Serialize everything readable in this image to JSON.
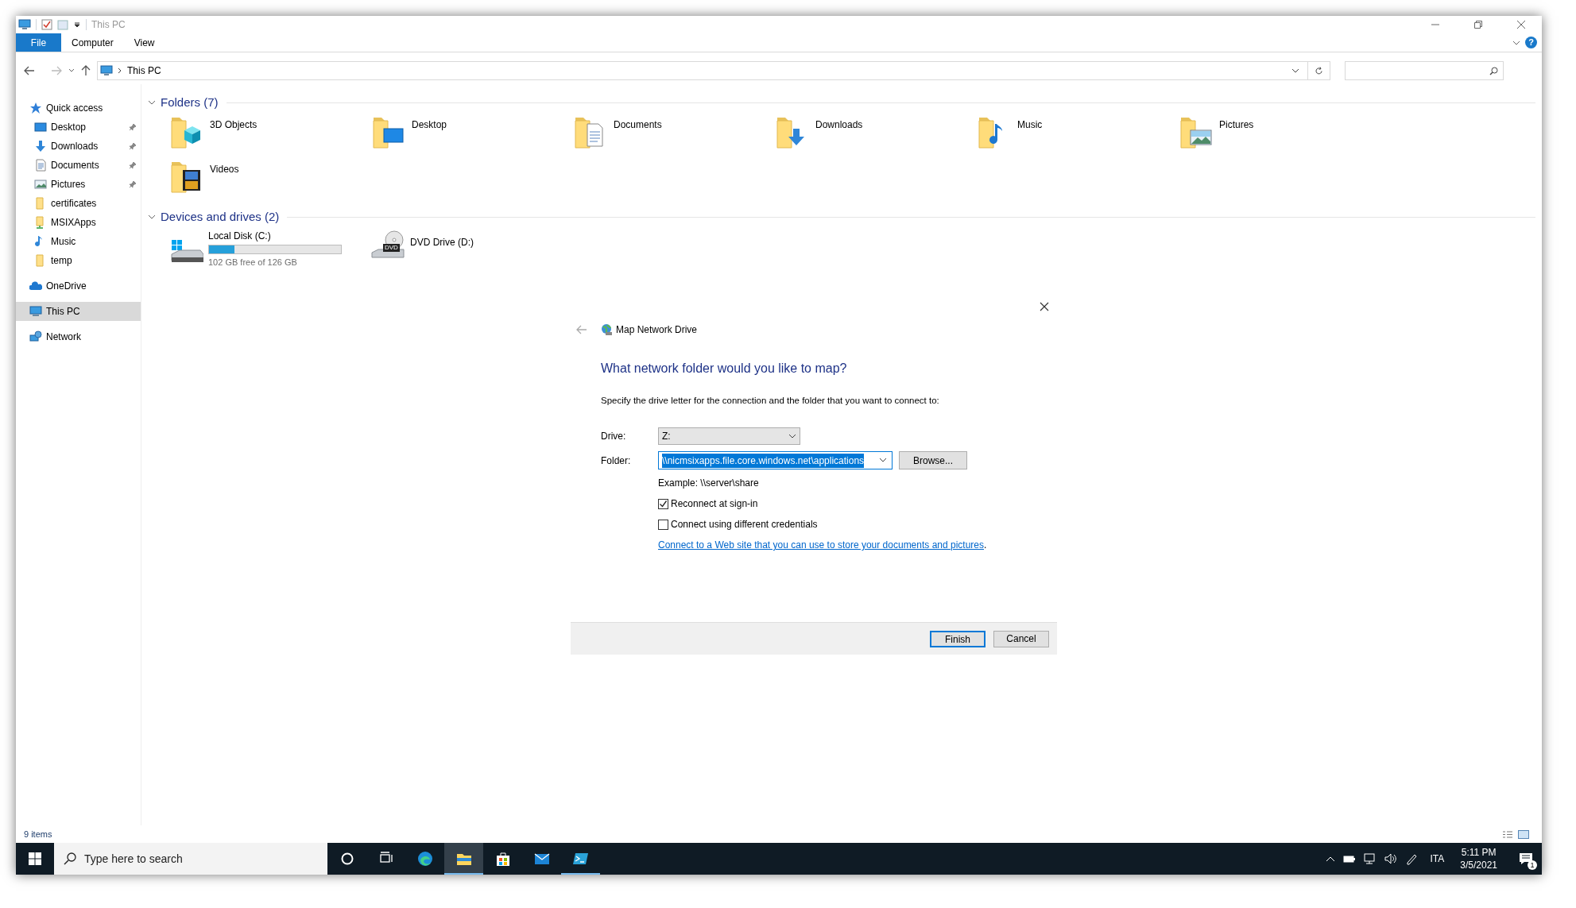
{
  "window": {
    "title": "This PC",
    "help": "?"
  },
  "ribbon": {
    "file_tab": "File",
    "tabs": [
      {
        "label": "Computer"
      },
      {
        "label": "View"
      }
    ]
  },
  "address_bar": {
    "path": "This PC"
  },
  "sidebar": {
    "items": [
      {
        "label": "Quick access",
        "kind": "star",
        "selected": false,
        "children": [
          {
            "label": "Desktop",
            "kind": "desktop",
            "pinned": true,
            "selected": false
          },
          {
            "label": "Downloads",
            "kind": "downloads",
            "pinned": true,
            "selected": false
          },
          {
            "label": "Documents",
            "kind": "documents",
            "pinned": true,
            "selected": false
          },
          {
            "label": "Pictures",
            "kind": "pictures",
            "pinned": true,
            "selected": false
          },
          {
            "label": "certificates",
            "kind": "folder",
            "pinned": false,
            "selected": false
          },
          {
            "label": "MSIXApps",
            "kind": "shared",
            "pinned": false,
            "selected": false
          },
          {
            "label": "Music",
            "kind": "music",
            "pinned": false,
            "selected": false
          },
          {
            "label": "temp",
            "kind": "folder",
            "pinned": false,
            "selected": false
          }
        ]
      },
      {
        "label": "OneDrive",
        "kind": "cloud",
        "selected": false
      },
      {
        "label": "This PC",
        "kind": "pc",
        "selected": true
      },
      {
        "label": "Network",
        "kind": "network",
        "selected": false
      }
    ]
  },
  "folders": {
    "header": "Folders (7)",
    "expanded": true,
    "items": [
      {
        "label": "3D Objects",
        "kind": "cube"
      },
      {
        "label": "Desktop",
        "kind": "desktop"
      },
      {
        "label": "Documents",
        "kind": "documents"
      },
      {
        "label": "Downloads",
        "kind": "downloads"
      },
      {
        "label": "Music",
        "kind": "music"
      },
      {
        "label": "Pictures",
        "kind": "pictures"
      },
      {
        "label": "Videos",
        "kind": "videos"
      }
    ]
  },
  "drives": {
    "header": "Devices and drives (2)",
    "expanded": true,
    "items": [
      {
        "label": "Local Disk (C:)",
        "kind": "disk",
        "level": 0.19,
        "free": "102 GB free of 126 GB"
      },
      {
        "label": "DVD Drive (D:)",
        "kind": "dvd",
        "badge": "DVD"
      }
    ]
  },
  "dialog": {
    "title": "Map Network Drive",
    "heading": "What network folder would you like to map?",
    "instruction": "Specify the drive letter for the connection and the folder that you want to connect to:",
    "drive_label": "Drive:",
    "drive_value": "Z:",
    "folder_label": "Folder:",
    "folder_value": "\\\\nicmsixapps.file.core.windows.net\\applications",
    "folder_text_selected": true,
    "browse": "Browse...",
    "example": "Example: \\\\server\\share",
    "options": [
      {
        "label": "Reconnect at sign-in",
        "checked": true
      },
      {
        "label": "Connect using different credentials",
        "checked": false
      }
    ],
    "link": "Connect to a Web site that you can use to store your documents and pictures",
    "link_suffix": ".",
    "buttons": [
      {
        "label": "Finish",
        "default": true
      },
      {
        "label": "Cancel",
        "default": false
      }
    ]
  },
  "status_bar": {
    "count": "9 items"
  },
  "taskbar": {
    "search_placeholder": "Type here to search",
    "apps": [
      {
        "kind": "cortana",
        "running": false,
        "selected": false
      },
      {
        "kind": "taskview",
        "running": false,
        "selected": false
      },
      {
        "kind": "edge",
        "running": false,
        "selected": false
      },
      {
        "kind": "explorer",
        "running": true,
        "selected": true
      },
      {
        "kind": "store",
        "running": false,
        "selected": false
      },
      {
        "kind": "mail",
        "running": false,
        "selected": false
      },
      {
        "kind": "terminal",
        "running": true,
        "selected": false
      }
    ],
    "language": "ITA",
    "time": "5:11 PM",
    "date": "3/5/2021",
    "notifications": "1"
  }
}
